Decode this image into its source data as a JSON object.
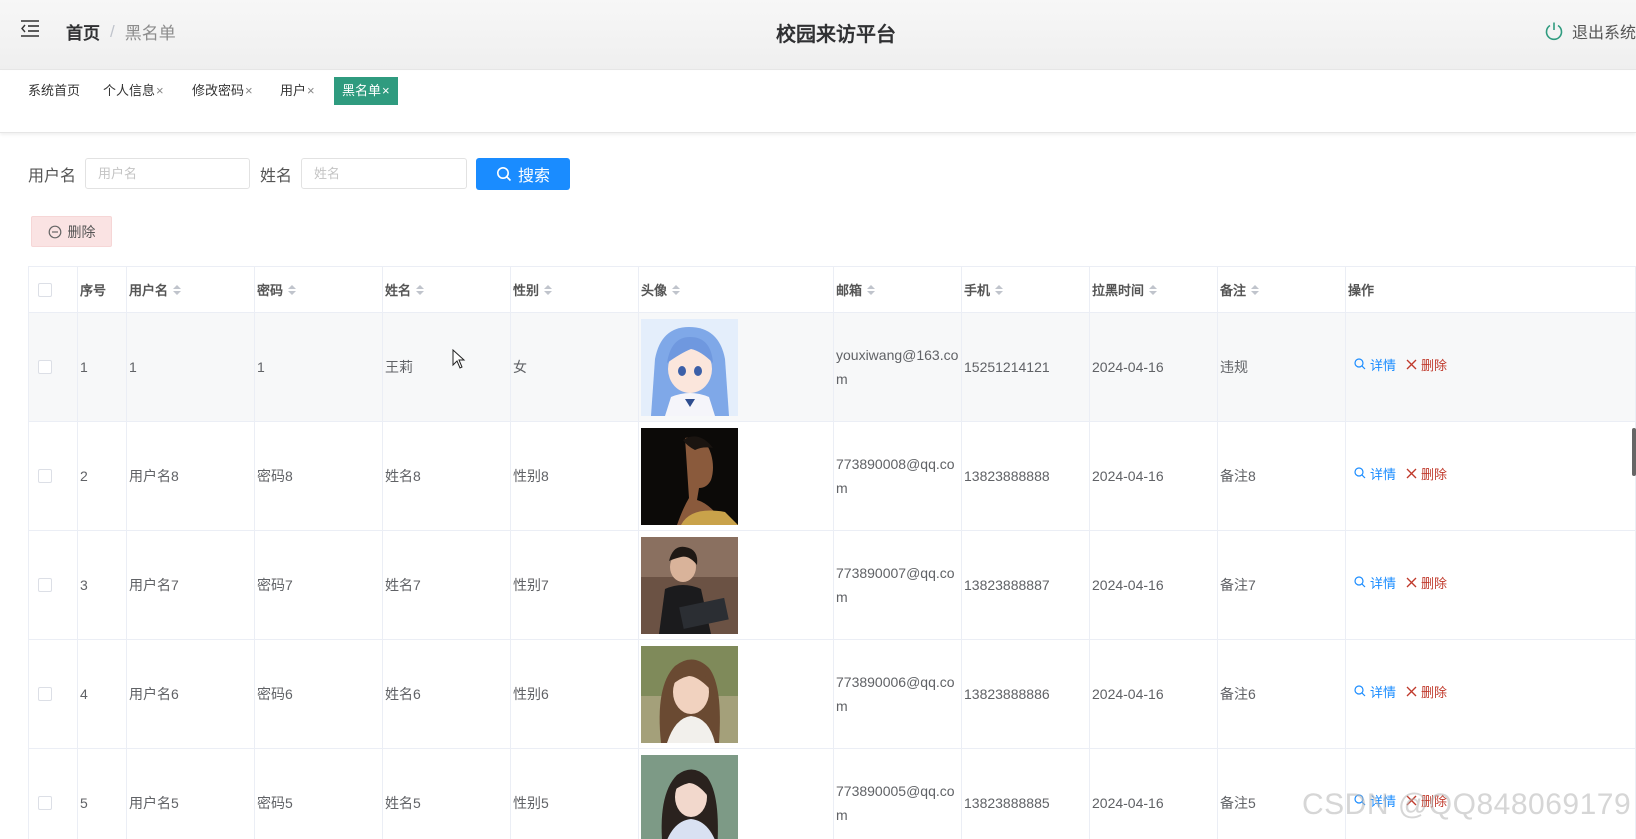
{
  "header": {
    "breadcrumb_home": "首页",
    "breadcrumb_sep": "/",
    "breadcrumb_current": "黑名单",
    "title": "校园来访平台",
    "logout_label": "退出系统"
  },
  "tags": [
    {
      "label": "系统首页",
      "closable": false,
      "active": false
    },
    {
      "label": "个人信息",
      "closable": true,
      "active": false
    },
    {
      "label": "修改密码",
      "closable": true,
      "active": false
    },
    {
      "label": "用户",
      "closable": true,
      "active": false
    },
    {
      "label": "黑名单",
      "closable": true,
      "active": true
    }
  ],
  "tag_close_glyph": "×",
  "search": {
    "username_label": "用户名",
    "username_placeholder": "用户名",
    "name_label": "姓名",
    "name_placeholder": "姓名",
    "button_label": "搜索"
  },
  "toolbar": {
    "delete_label": "删除"
  },
  "table": {
    "columns": [
      "序号",
      "用户名",
      "密码",
      "姓名",
      "性别",
      "头像",
      "邮箱",
      "手机",
      "拉黑时间",
      "备注",
      "操作"
    ],
    "rows": [
      {
        "index": "1",
        "username": "1",
        "password": "1",
        "name": "王莉",
        "gender": "女",
        "avatar": "anime-girl-blue-hair",
        "email": "youxiwang@163.com",
        "phone": "15251214121",
        "time": "2024-04-16",
        "note": "违规"
      },
      {
        "index": "2",
        "username": "用户名8",
        "password": "密码8",
        "name": "姓名8",
        "gender": "性别8",
        "avatar": "young-man-dark-profile",
        "email": "773890008@qq.com",
        "phone": "13823888888",
        "time": "2024-04-16",
        "note": "备注8"
      },
      {
        "index": "3",
        "username": "用户名7",
        "password": "密码7",
        "name": "姓名7",
        "gender": "性别7",
        "avatar": "young-man-with-laptop",
        "email": "773890007@qq.com",
        "phone": "13823888887",
        "time": "2024-04-16",
        "note": "备注7"
      },
      {
        "index": "4",
        "username": "用户名6",
        "password": "密码6",
        "name": "姓名6",
        "gender": "性别6",
        "avatar": "young-woman-braids",
        "email": "773890006@qq.com",
        "phone": "13823888886",
        "time": "2024-04-16",
        "note": "备注6"
      },
      {
        "index": "5",
        "username": "用户名5",
        "password": "密码5",
        "name": "姓名5",
        "gender": "性别5",
        "avatar": "young-woman-blue-shirt",
        "email": "773890005@qq.com",
        "phone": "13823888885",
        "time": "2024-04-16",
        "note": "备注5"
      }
    ],
    "op_detail": "详情",
    "op_delete": "删除"
  },
  "watermark": "CSDN @QQ848069179",
  "colors": {
    "primary": "#1a8cff",
    "active_tag": "#2f9b7f",
    "danger_text": "#c0392b",
    "danger_bg": "#fae3e3"
  }
}
